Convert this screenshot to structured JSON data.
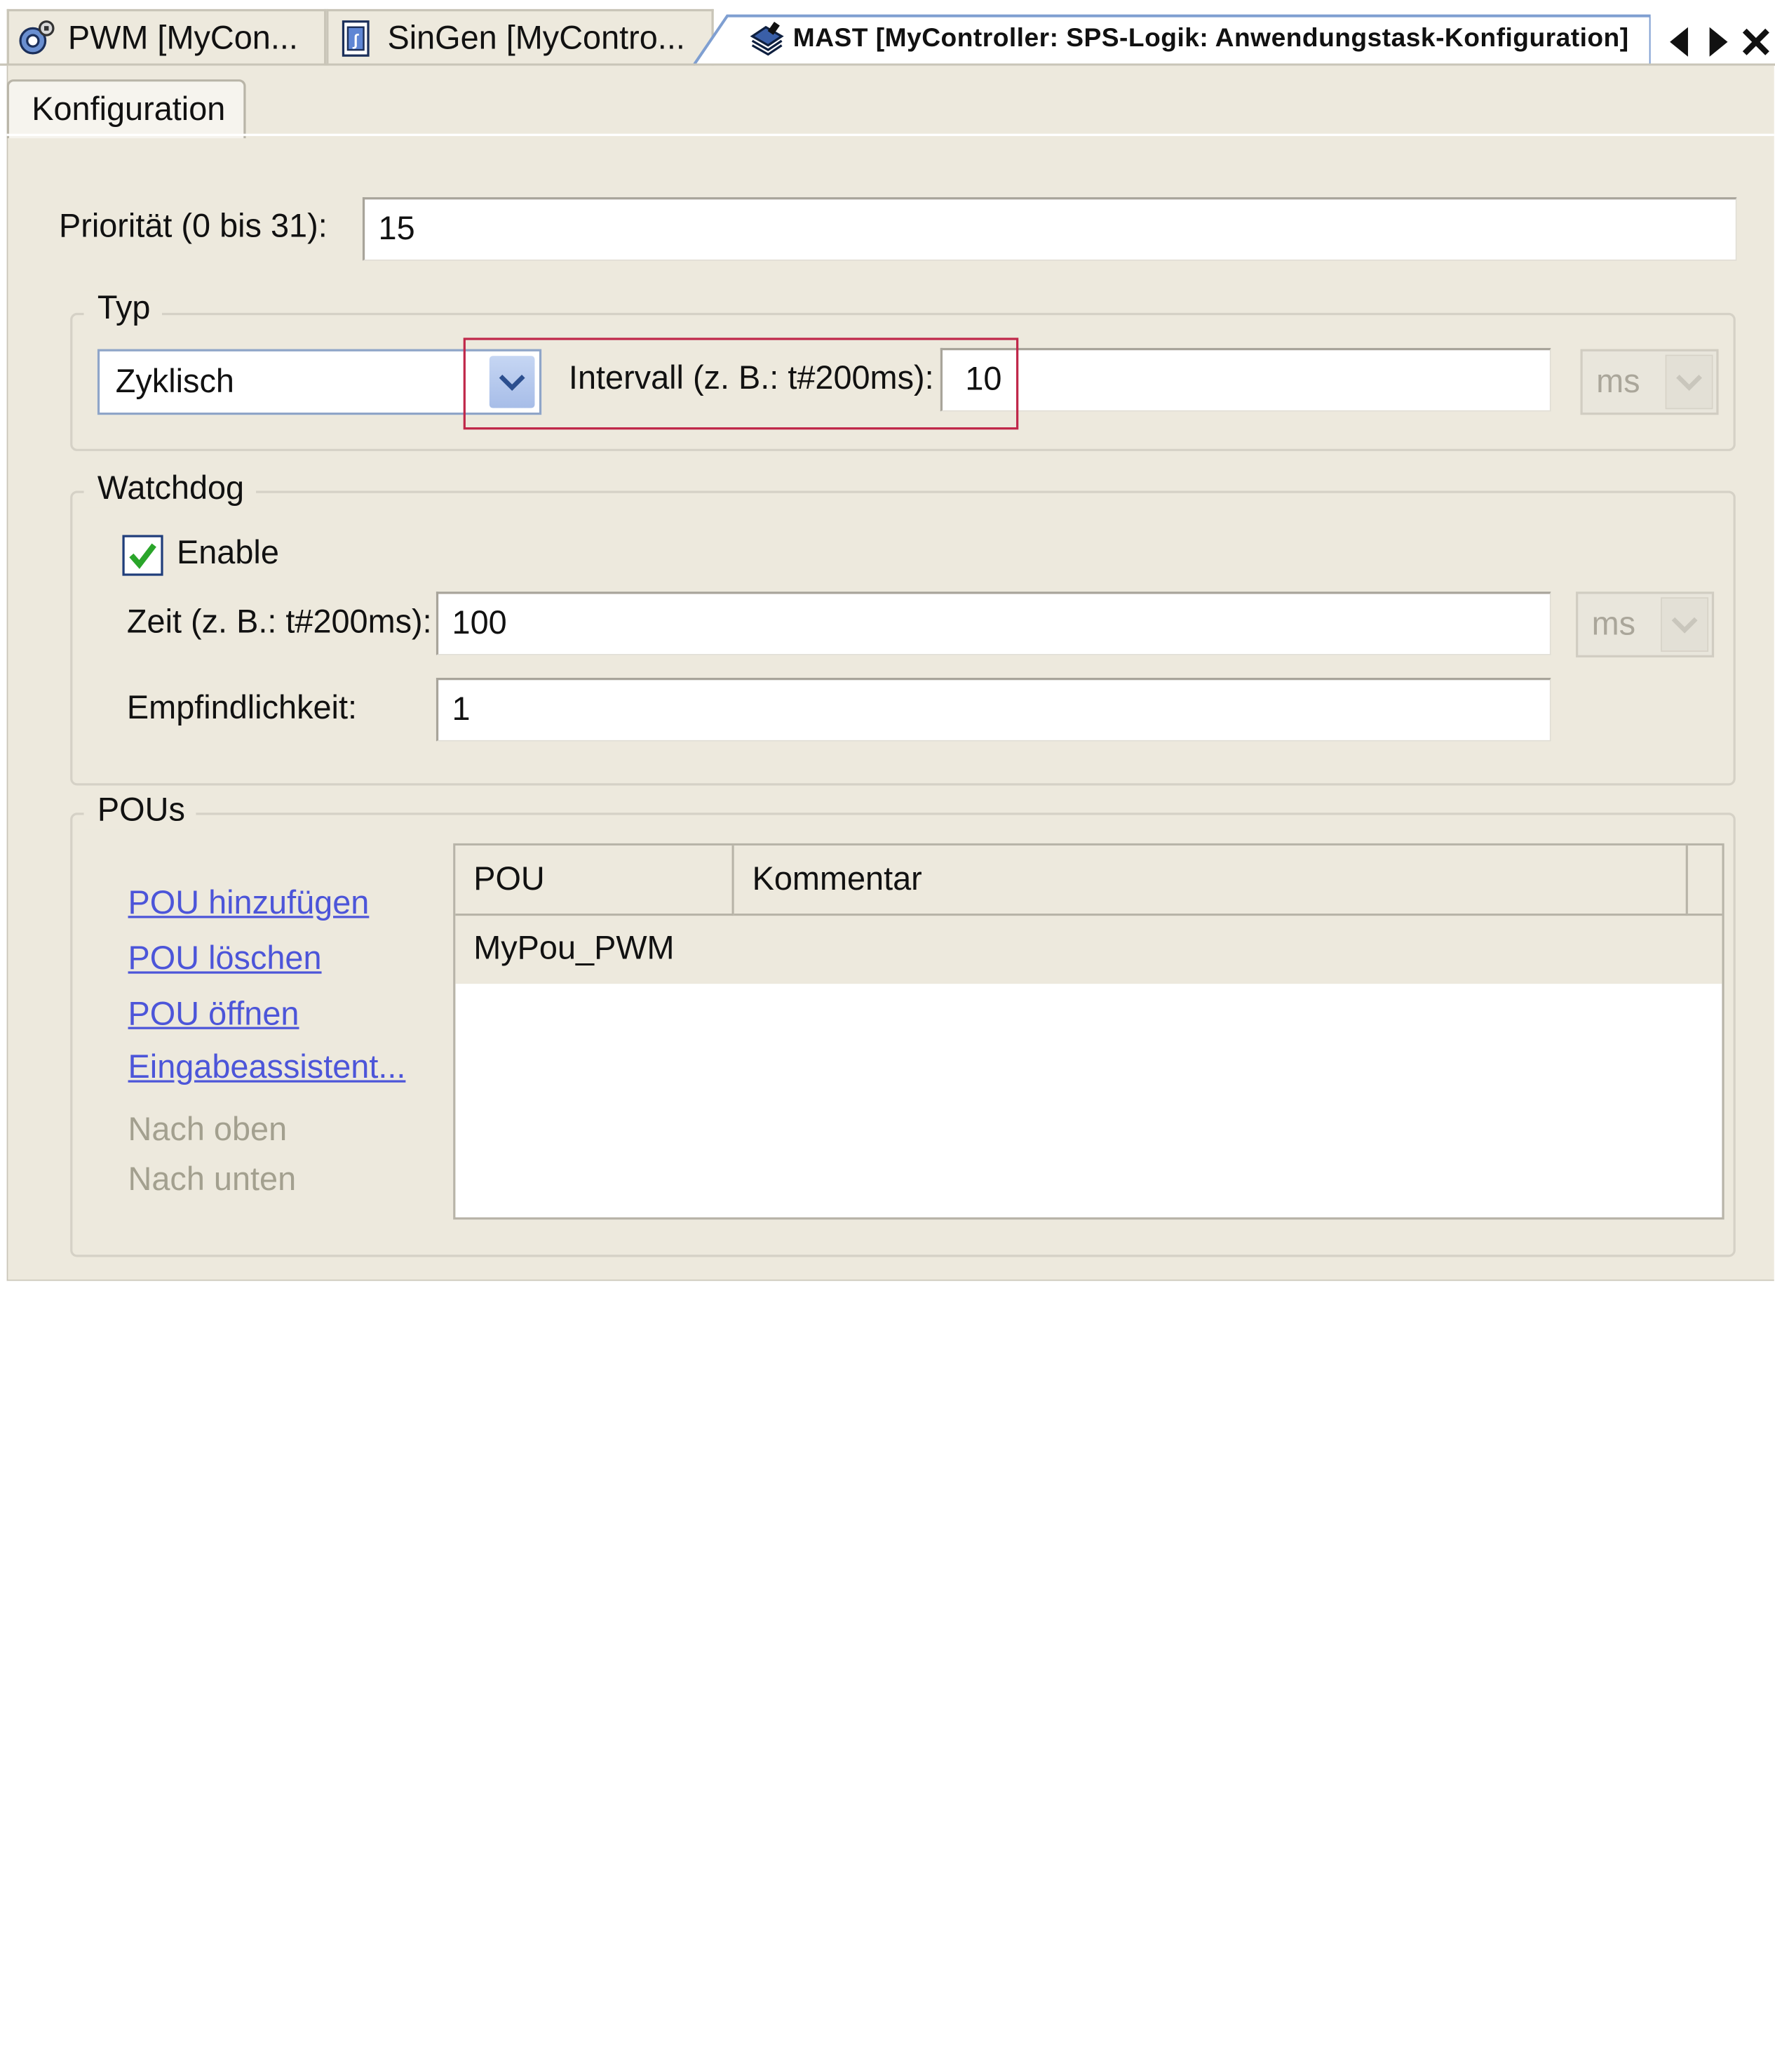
{
  "editor_tabs": [
    {
      "label": "PWM [MyCon...",
      "icon": "pwm-config-icon"
    },
    {
      "label": "SinGen [MyContro...",
      "icon": "program-icon"
    },
    {
      "label": "MAST [MyController: SPS-Logik: Anwendungstask-Konfiguration]",
      "icon": "task-icon"
    }
  ],
  "sub_tab": {
    "label": "Konfiguration"
  },
  "priority": {
    "label": "Priorität (0 bis 31):",
    "value": "15"
  },
  "type_group": {
    "title": "Typ",
    "type_value": "Zyklisch",
    "interval_label": "Intervall (z. B.: t#200ms):",
    "interval_value": "10",
    "interval_unit": "ms"
  },
  "watchdog_group": {
    "title": "Watchdog",
    "enable_label": "Enable",
    "enable_checked": true,
    "time_label": "Zeit (z. B.: t#200ms):",
    "time_value": "100",
    "time_unit": "ms",
    "sensitivity_label": "Empfindlichkeit:",
    "sensitivity_value": "1"
  },
  "pous_group": {
    "title": "POUs",
    "actions": [
      "POU hinzufügen",
      "POU löschen",
      "POU öffnen",
      "Eingabeassistent..."
    ],
    "disabled_actions": [
      "Nach oben",
      "Nach unten"
    ],
    "table": {
      "columns": [
        "POU",
        "Kommentar"
      ],
      "rows": [
        {
          "pou": "MyPou_PWM",
          "comment": ""
        }
      ]
    }
  },
  "colors": {
    "panel_bg": "#ede9dd",
    "highlight": "#c0284a",
    "link": "#4c55d9",
    "check": "#2aa52a"
  }
}
